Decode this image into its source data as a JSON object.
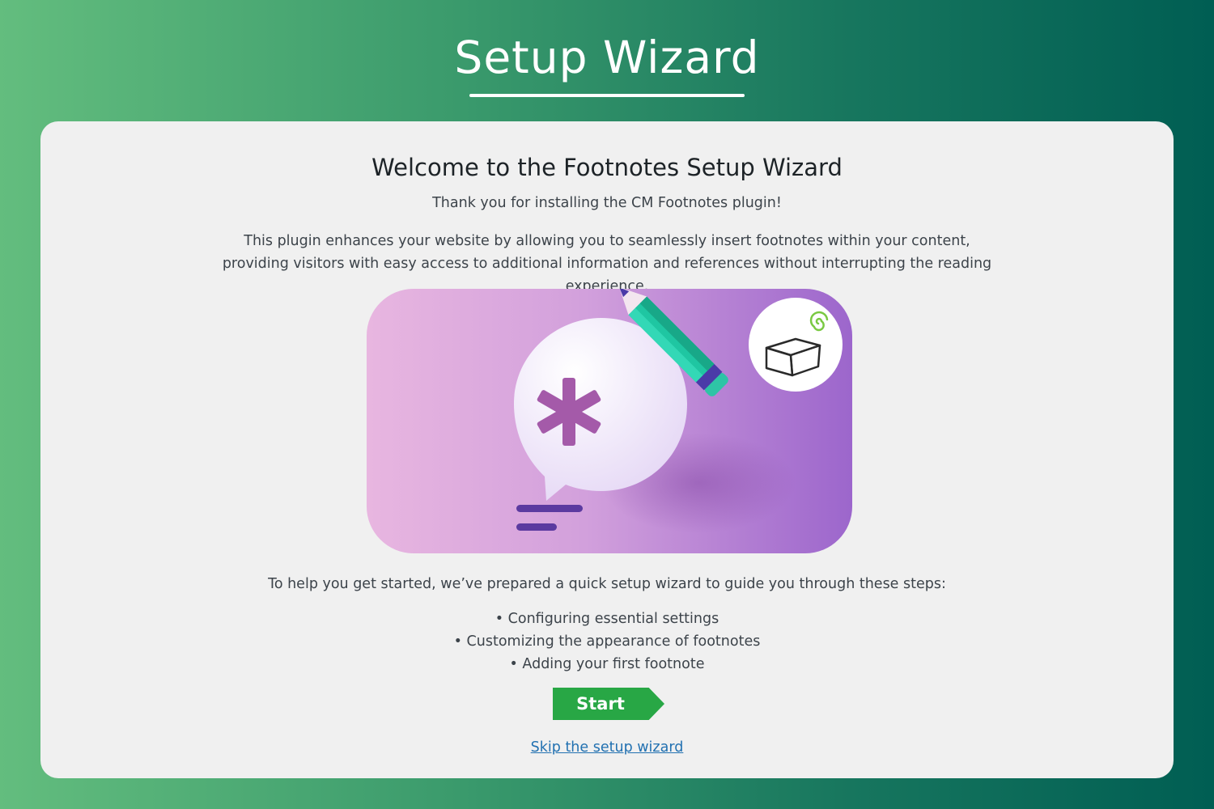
{
  "header": {
    "title": "Setup Wizard"
  },
  "welcome": {
    "heading": "Welcome to the Footnotes Setup Wizard",
    "thank_you": "Thank you for installing the CM Footnotes plugin!",
    "description": "This plugin enhances your website by allowing you to seamlessly insert footnotes within your content, providing visitors with easy access to additional information and references without interrupting the reading experience."
  },
  "hero_image": {
    "icons": [
      "speech-bubble-icon",
      "asterisk-icon",
      "pencil-icon",
      "text-lines-icon",
      "box-logo-icon",
      "spiral-icon"
    ]
  },
  "steps": {
    "intro": "To help you get started, we’ve prepared a quick setup wizard to guide you through these steps:",
    "items": [
      "• Configuring essential settings",
      "• Customizing the appearance of footnotes",
      "• Adding your first footnote"
    ]
  },
  "actions": {
    "start_label": "Start",
    "skip_label": "Skip the setup wizard"
  },
  "colors": {
    "background_left": "#63bd7e",
    "background_right": "#005e53",
    "card": "#f0f0f0",
    "start_button": "#28a745",
    "link": "#2271b1"
  }
}
